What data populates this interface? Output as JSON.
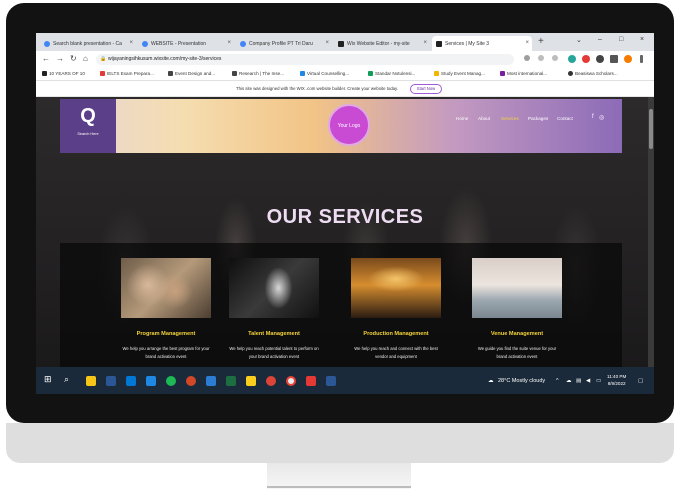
{
  "browser": {
    "tabs": [
      {
        "label": "Search blank presentation - Ca",
        "color": "#1a73e8"
      },
      {
        "label": "WEBSITE - Presentation",
        "color": "#1a73e8"
      },
      {
        "label": "Company Profile PT Tri Daru",
        "color": "#1a73e8"
      },
      {
        "label": "Wix Website Editor - my-site",
        "color": "#000000"
      },
      {
        "label": "Services | My Site 3",
        "color": "#000000"
      }
    ],
    "new_tab": "+",
    "controls": {
      "minimize": "–",
      "maximize": "□",
      "close": "×",
      "chevron": "⌄"
    },
    "url": "wijayaningsihkusum.wixsite.com/my-site-3/services",
    "bookmarks": [
      {
        "label": "10 YEARS OF 10",
        "color": "#222222"
      },
      {
        "label": "IELTS Exam Prepara...",
        "color": "#e53935"
      },
      {
        "label": "Event Design and...",
        "color": "#444444"
      },
      {
        "label": "Research | The Inse...",
        "color": "#444444"
      },
      {
        "label": "Virtual Counselling...",
        "color": "#1e88e5"
      },
      {
        "label": "Standar Notulensi...",
        "color": "#0f9d58"
      },
      {
        "label": "Study Event Manag...",
        "color": "#f4b400"
      },
      {
        "label": "Most international...",
        "color": "#7b1fa2"
      },
      {
        "label": "Beasiswa Scholars...",
        "color": "#333333"
      }
    ]
  },
  "wix_banner": {
    "text": "This site was designed with the WIX .com website builder. Create your website today.",
    "button": "Start Now"
  },
  "site": {
    "logo_letter": "Q",
    "logo_sub": "Search Here",
    "center_logo": "Your Logo",
    "nav": [
      "Home",
      "About",
      "Services",
      "Packages",
      "Contact"
    ],
    "social": [
      "f",
      "◎"
    ],
    "page_title": "OUR SERVICES",
    "services": [
      {
        "title": "Program Management",
        "desc": "We help you arrange the best program for your brand activation event"
      },
      {
        "title": "Talent Management",
        "desc": "We help you reach potential talent to perform on your brand activation event"
      },
      {
        "title": "Production Management",
        "desc": "We help you reach and connect with the best vendor and equipment"
      },
      {
        "title": "Venue Management",
        "desc": "We guide you find the suite venue for your brand activation event"
      }
    ]
  },
  "taskbar": {
    "weather": "28°C  Mostly cloudy",
    "time": "11:40 PM",
    "date": "8/9/2022",
    "tray_arrow": "^"
  }
}
